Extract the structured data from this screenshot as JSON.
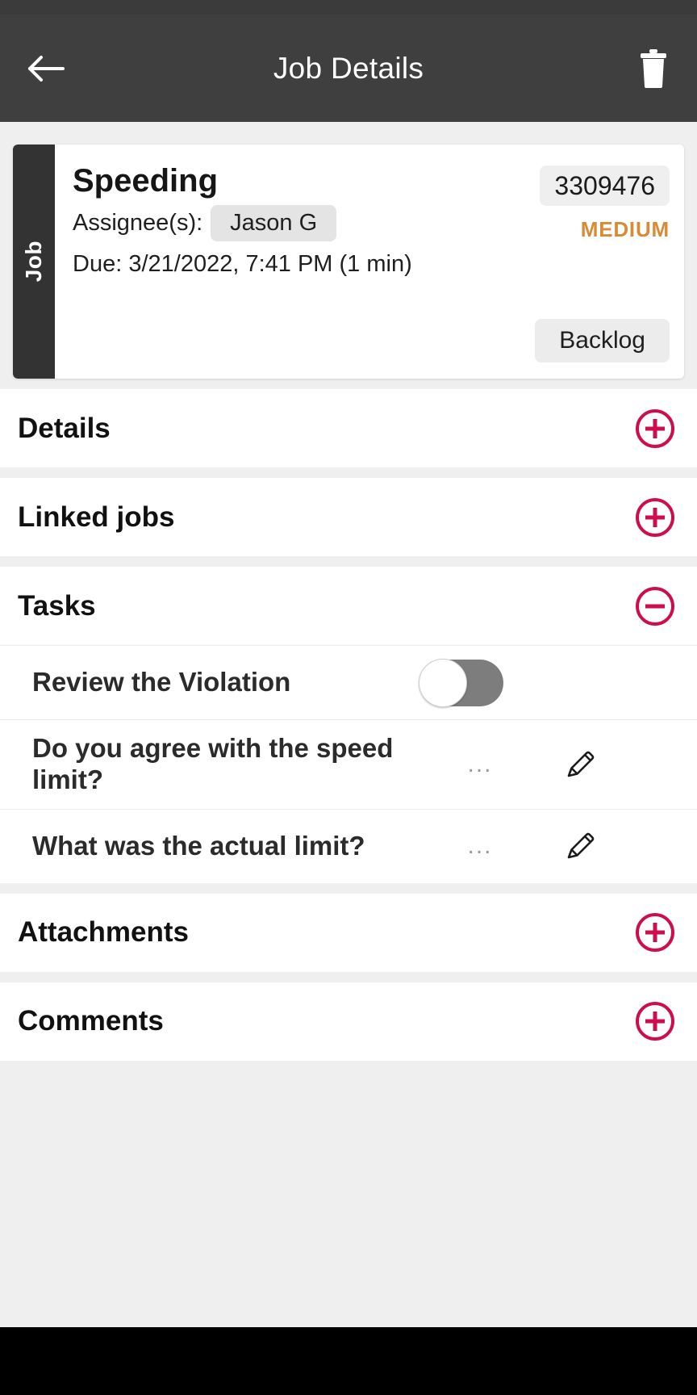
{
  "appbar": {
    "title": "Job Details",
    "back_icon": "arrow-left-icon",
    "delete_icon": "trash-icon"
  },
  "job_card": {
    "tab_label": "Job",
    "title": "Speeding",
    "id": "3309476",
    "priority": "MEDIUM",
    "priority_color": "#d98a35",
    "assignee_label": "Assignee(s):",
    "assignees": [
      "Jason G"
    ],
    "due": "Due: 3/21/2022, 7:41 PM (1 min)",
    "status": "Backlog"
  },
  "sections": [
    {
      "title": "Details",
      "expanded": false,
      "icon": "plus-circle-icon"
    },
    {
      "title": "Linked jobs",
      "expanded": false,
      "icon": "plus-circle-icon"
    },
    {
      "title": "Tasks",
      "expanded": true,
      "icon": "minus-circle-icon"
    },
    {
      "title": "Attachments",
      "expanded": false,
      "icon": "plus-circle-icon"
    },
    {
      "title": "Comments",
      "expanded": false,
      "icon": "plus-circle-icon"
    }
  ],
  "tasks": [
    {
      "label": "Review the Violation",
      "control": "switch",
      "checked": false,
      "value": ""
    },
    {
      "label": "Do you agree with the speed limit?",
      "control": "edit",
      "value": "...",
      "icon": "pencil-icon"
    },
    {
      "label": "What was the actual limit?",
      "control": "edit",
      "value": "...",
      "icon": "pencil-icon"
    }
  ],
  "colors": {
    "accent": "#cc0e4e",
    "appbar_bg": "#3f3f3f",
    "page_bg": "#efefef",
    "card_bg": "#ffffff",
    "job_tab_bg": "#333333",
    "switch_track": "#7d7d7d"
  }
}
